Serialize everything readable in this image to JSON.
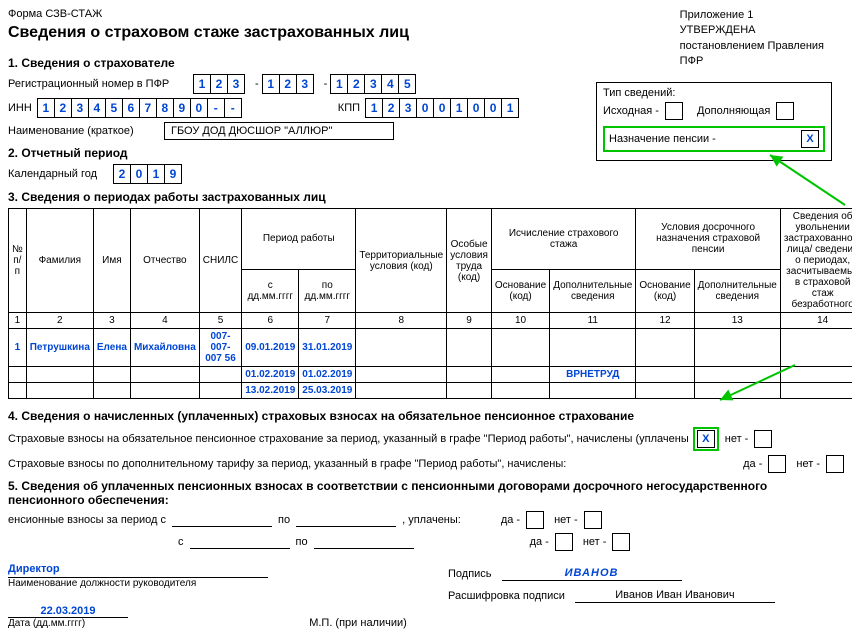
{
  "header": {
    "form_code": "Форма СЗВ-СТАЖ",
    "appendix": "Приложение 1",
    "approved1": "УТВЕРЖДЕНА",
    "approved2": "постановлением Правления",
    "approved3": "ПФР"
  },
  "title": "Сведения о страховом стаже застрахованных лиц",
  "section1": {
    "head": "1. Сведения о страхователе",
    "reg_label": "Регистрационный номер в ПФР",
    "reg": [
      "1",
      "2",
      "3",
      "1",
      "2",
      "3",
      "1",
      "2",
      "3",
      "4",
      "5"
    ],
    "inn_label": "ИНН",
    "inn": [
      "1",
      "2",
      "3",
      "4",
      "5",
      "6",
      "7",
      "8",
      "9",
      "0",
      "-",
      "-"
    ],
    "kpp_label": "КПП",
    "kpp": [
      "1",
      "2",
      "3",
      "0",
      "0",
      "1",
      "0",
      "0",
      "1"
    ],
    "name_label": "Наименование (краткое)",
    "name_value": "ГБОУ ДОД ДЮСШОР \"АЛЛЮР\""
  },
  "type_box": {
    "title": "Тип сведений:",
    "row1a": "Исходная -",
    "row1b": "Дополняющая",
    "row2": "Назначение пенсии -",
    "row2_mark": "X"
  },
  "section2": {
    "head": "2. Отчетный период",
    "label": "Календарный год",
    "year": [
      "2",
      "0",
      "1",
      "9"
    ]
  },
  "section3": {
    "head": "3. Сведения о периодах работы застрахованных лиц",
    "cols": {
      "c1": "№ п/п",
      "c2": "Фамилия",
      "c3": "Имя",
      "c4": "Отчество",
      "c5": "СНИЛС",
      "c6": "Период работы",
      "c6a": "с дд.мм.гггг",
      "c6b": "по дд.мм.гггг",
      "c7": "Территориальные условия (код)",
      "c8": "Особые условия труда (код)",
      "c9": "Исчисление страхового стажа",
      "c9a": "Основание (код)",
      "c9b": "Дополнительные сведения",
      "c10": "Условия досрочного назначения страховой пенсии",
      "c10a": "Основание (код)",
      "c10b": "Дополнительные сведения",
      "c11": "Сведения об увольнении застрахованного лица/ сведения о периодах, засчитываемых в страховой стаж безработного"
    },
    "numrow": [
      "1",
      "2",
      "3",
      "4",
      "5",
      "6",
      "7",
      "8",
      "9",
      "10",
      "11",
      "12",
      "13",
      "14"
    ],
    "rows": [
      {
        "n": "1",
        "f": "Петрушкина",
        "i": "Елена",
        "o": "Михайловна",
        "snils": "007-007-007 56",
        "from": "09.01.2019",
        "to": "31.01.2019",
        "t": "",
        "osp": "",
        "b1": "",
        "d1": "",
        "b2": "",
        "d2": "",
        "u": ""
      },
      {
        "n": "",
        "f": "",
        "i": "",
        "o": "",
        "snils": "",
        "from": "01.02.2019",
        "to": "01.02.2019",
        "t": "",
        "osp": "",
        "b1": "",
        "d1": "ВРНЕТРУД",
        "b2": "",
        "d2": "",
        "u": ""
      },
      {
        "n": "",
        "f": "",
        "i": "",
        "o": "",
        "snils": "",
        "from": "13.02.2019",
        "to": "25.03.2019",
        "t": "",
        "osp": "",
        "b1": "",
        "d1": "",
        "b2": "",
        "d2": "",
        "u": ""
      }
    ]
  },
  "section4": {
    "head": "4. Сведения о начисленных (уплаченных) страховых взносах на обязательное пенсионное страхование",
    "line1": "Страховые взносы на обязательное пенсионное страхование за период, указанный в графе \"Период работы\", начислены (уплачены",
    "line2": "Страховые взносы по дополнительному тарифу за период, указанный в графе \"Период работы\", начислены:",
    "da": "да -",
    "net": "нет -",
    "x": "X"
  },
  "section5": {
    "head": "5. Сведения об уплаченных пенсионных взносах в соответствии с пенсионными договорами досрочного негосударственного пенсионного обеспечения:",
    "line_a": "енсионные взносы за период с",
    "po": "по",
    "upl": ", уплачены:",
    "s": "с",
    "da": "да -",
    "net": "нет -"
  },
  "sign": {
    "director": "Директор",
    "post_label": "Наименование должности руководителя",
    "date": "22.03.2019",
    "date_label": "Дата (дд.мм.гггг)",
    "mp": "М.П. (при наличии)",
    "sig_label": "Подпись",
    "sig_value": "ИВАНОВ",
    "decode_label": "Расшифровка подписи",
    "decode_value": "Иванов Иван Иванович"
  }
}
